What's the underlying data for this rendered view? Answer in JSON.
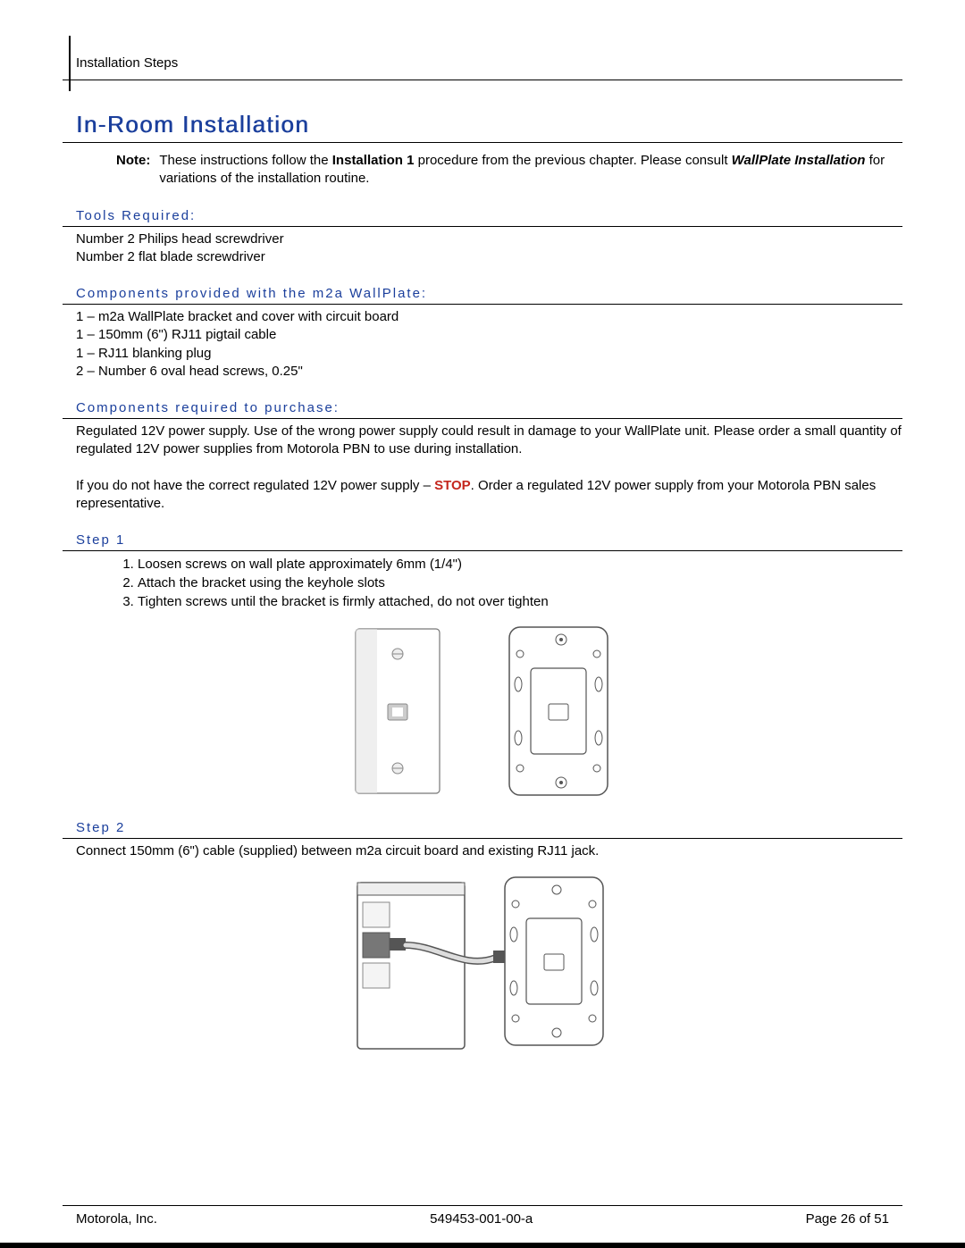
{
  "header": {
    "breadcrumb": "Installation Steps"
  },
  "title": "In-Room Installation",
  "note": {
    "label": "Note:",
    "text_pre": "These instructions follow the ",
    "bold1": "Installation 1",
    "text_mid": " procedure from the previous chapter.  Please consult ",
    "bolditalic": "WallPlate Installation",
    "text_post": " for variations of the installation routine."
  },
  "sections": {
    "tools": {
      "heading": "Tools Required:",
      "lines": [
        "Number 2 Philips head screwdriver",
        "Number 2 flat blade screwdriver"
      ]
    },
    "provided": {
      "heading": "Components provided with the m2a WallPlate:",
      "lines": [
        "1 – m2a WallPlate bracket and cover with circuit board",
        "1 – 150mm (6\") RJ11 pigtail cable",
        "1 – RJ11 blanking plug",
        "2 – Number 6 oval head screws, 0.25\""
      ]
    },
    "purchase": {
      "heading": "Components required to purchase:",
      "p1": "Regulated 12V power supply.  Use of the wrong power supply could result in damage to your WallPlate unit.  Please order a small quantity of regulated 12V power supplies from Motorola PBN to use during installation.",
      "p2_pre": "If you do not have the correct regulated 12V power supply – ",
      "p2_stop": "STOP",
      "p2_post": ".  Order a regulated 12V power supply from your Motorola PBN sales representative."
    },
    "step1": {
      "heading": "Step 1",
      "items": [
        "Loosen screws on wall plate approximately 6mm (1/4\")",
        "Attach the bracket using the keyhole slots",
        "Tighten screws until the bracket is firmly attached, do not over tighten"
      ]
    },
    "step2": {
      "heading": "Step 2",
      "text": "Connect 150mm (6\") cable (supplied) between m2a circuit board and existing RJ11 jack."
    }
  },
  "footer": {
    "left": "Motorola, Inc.",
    "center": "549453-001-00-a",
    "right": "Page 26 of 51"
  }
}
